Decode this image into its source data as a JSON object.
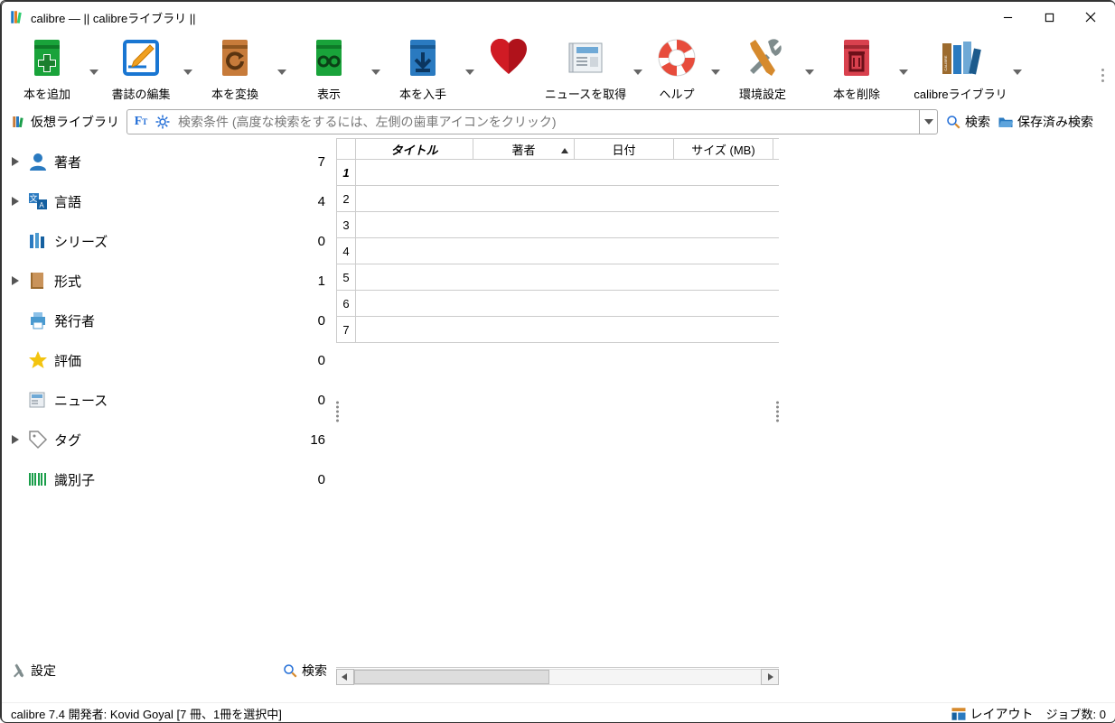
{
  "window": {
    "title": "calibre — || calibreライブラリ ||"
  },
  "toolbar": {
    "items": [
      {
        "id": "add",
        "label": "本を追加"
      },
      {
        "id": "edit",
        "label": "書誌の編集"
      },
      {
        "id": "convert",
        "label": "本を変換"
      },
      {
        "id": "view",
        "label": "表示"
      },
      {
        "id": "get",
        "label": "本を入手"
      },
      {
        "id": "donate",
        "label": ""
      },
      {
        "id": "news",
        "label": "ニュースを取得"
      },
      {
        "id": "help",
        "label": "ヘルプ"
      },
      {
        "id": "prefs",
        "label": "環境設定"
      },
      {
        "id": "remove",
        "label": "本を削除"
      },
      {
        "id": "library",
        "label": "calibreライブラリ"
      }
    ]
  },
  "searchrow": {
    "virtual_library": "仮想ライブラリ",
    "placeholder": "検索条件 (高度な検索をするには、左側の歯車アイコンをクリック)",
    "go": "検索",
    "saved": "保存済み検索"
  },
  "sidebar": {
    "categories": [
      {
        "id": "authors",
        "label": "著者",
        "count": 7,
        "expandable": true
      },
      {
        "id": "languages",
        "label": "言語",
        "count": 4,
        "expandable": true
      },
      {
        "id": "series",
        "label": "シリーズ",
        "count": 0,
        "expandable": false
      },
      {
        "id": "formats",
        "label": "形式",
        "count": 1,
        "expandable": true
      },
      {
        "id": "publishers",
        "label": "発行者",
        "count": 0,
        "expandable": false
      },
      {
        "id": "ratings",
        "label": "評価",
        "count": 0,
        "expandable": false
      },
      {
        "id": "news",
        "label": "ニュース",
        "count": 0,
        "expandable": false
      },
      {
        "id": "tags",
        "label": "タグ",
        "count": 16,
        "expandable": true
      },
      {
        "id": "identifiers",
        "label": "識別子",
        "count": 0,
        "expandable": false
      }
    ],
    "settings": "設定",
    "search": "検索"
  },
  "grid": {
    "columns": {
      "title": "タイトル",
      "author": "著者",
      "date": "日付",
      "size": "サイズ (MB)"
    },
    "rows": [
      1,
      2,
      3,
      4,
      5,
      6,
      7
    ],
    "selected_row": 1
  },
  "status": {
    "left": "calibre 7.4 開発者:  Kovid Goyal    [7 冊、1冊を選択中]",
    "layout": "レイアウト",
    "jobs": "ジョブ数: 0"
  }
}
